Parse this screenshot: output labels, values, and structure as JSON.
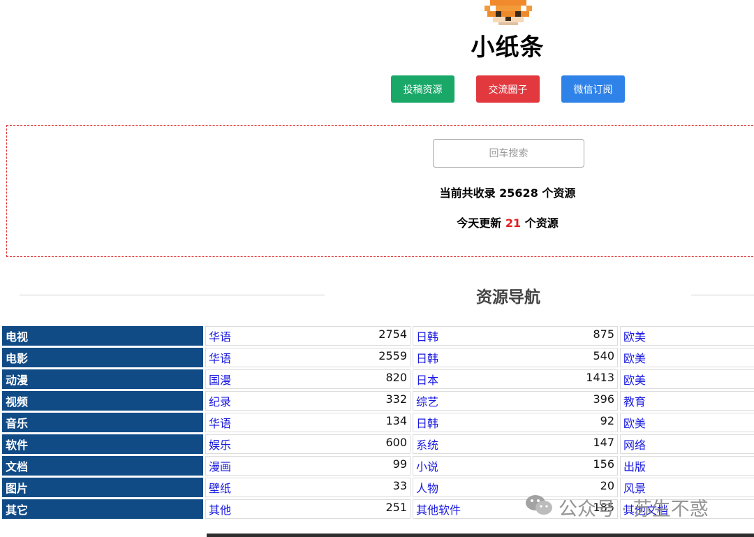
{
  "header": {
    "site_title": "小纸条",
    "buttons": {
      "submit": "投稿资源",
      "community": "交流圈子",
      "wechat": "微信订阅"
    }
  },
  "search": {
    "placeholder": "回车搜索"
  },
  "stats": {
    "total_prefix": "当前共收录",
    "total_count": "25628",
    "total_suffix": "个资源",
    "today_prefix": "今天更新",
    "today_count": "21",
    "today_suffix": "个资源"
  },
  "nav": {
    "title": "资源导航"
  },
  "table": {
    "rows": [
      {
        "category": "电视",
        "c1": {
          "label": "华语",
          "count": "2754"
        },
        "c2": {
          "label": "日韩",
          "count": "875"
        },
        "c3": {
          "label": "欧美"
        }
      },
      {
        "category": "电影",
        "c1": {
          "label": "华语",
          "count": "2559"
        },
        "c2": {
          "label": "日韩",
          "count": "540"
        },
        "c3": {
          "label": "欧美"
        }
      },
      {
        "category": "动漫",
        "c1": {
          "label": "国漫",
          "count": "820"
        },
        "c2": {
          "label": "日本",
          "count": "1413"
        },
        "c3": {
          "label": "欧美"
        }
      },
      {
        "category": "视频",
        "c1": {
          "label": "纪录",
          "count": "332"
        },
        "c2": {
          "label": "综艺",
          "count": "396"
        },
        "c3": {
          "label": "教育"
        }
      },
      {
        "category": "音乐",
        "c1": {
          "label": "华语",
          "count": "134"
        },
        "c2": {
          "label": "日韩",
          "count": "92"
        },
        "c3": {
          "label": "欧美"
        }
      },
      {
        "category": "软件",
        "c1": {
          "label": "娱乐",
          "count": "600"
        },
        "c2": {
          "label": "系统",
          "count": "147"
        },
        "c3": {
          "label": "网络"
        }
      },
      {
        "category": "文档",
        "c1": {
          "label": "漫画",
          "count": "99"
        },
        "c2": {
          "label": "小说",
          "count": "156"
        },
        "c3": {
          "label": "出版"
        }
      },
      {
        "category": "图片",
        "c1": {
          "label": "壁纸",
          "count": "33"
        },
        "c2": {
          "label": "人物",
          "count": "20"
        },
        "c3": {
          "label": "风景"
        }
      },
      {
        "category": "其它",
        "c1": {
          "label": "其他",
          "count": "251"
        },
        "c2": {
          "label": "其他软件",
          "count": "185"
        },
        "c3": {
          "label": "其他文档"
        }
      }
    ]
  },
  "watermark": {
    "text": "公众号 · 苏生不惑",
    "icon": "wechat-icon"
  },
  "colors": {
    "green_button": "#1aa869",
    "red_button": "#e2393f",
    "blue_button": "#2f82e8",
    "category_bg": "#114b86",
    "link": "#1a1ae0",
    "highlight": "#e02020"
  }
}
